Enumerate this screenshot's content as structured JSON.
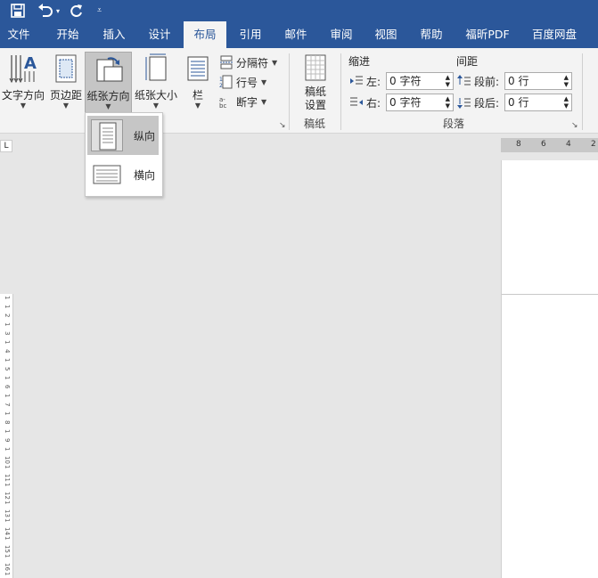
{
  "qat": {
    "save_icon": "save-icon",
    "undo_icon": "undo-icon",
    "redo_icon": "repeat-icon",
    "customize_icon": "customize-qat-icon"
  },
  "tabs": [
    "文件",
    "开始",
    "插入",
    "设计",
    "布局",
    "引用",
    "邮件",
    "审阅",
    "视图",
    "帮助",
    "福昕PDF",
    "百度网盘"
  ],
  "active_tab": "布局",
  "ribbon": {
    "text_direction": "文字方向",
    "margins": "页边距",
    "orientation": "纸张方向",
    "size": "纸张大小",
    "columns": "栏",
    "breaks": "分隔符",
    "line_numbers": "行号",
    "hyphenation": "断字",
    "draft_paper": "稿纸\n设置",
    "draft_paper_line1": "稿纸",
    "draft_paper_line2": "设置",
    "draft_group": "稿纸",
    "indent_label": "缩进",
    "spacing_label": "间距",
    "left_label": "左:",
    "right_label": "右:",
    "before_label": "段前:",
    "after_label": "段后:",
    "left_value": "0 字符",
    "right_value": "0 字符",
    "before_value": "0 行",
    "after_value": "0 行",
    "paragraph_group": "段落"
  },
  "orientation_menu": {
    "portrait": "纵向",
    "landscape": "横向"
  },
  "ruler": {
    "h_ticks": [
      "8",
      "6",
      "4",
      "2"
    ],
    "v_ticks": [
      "1",
      "1",
      "2",
      "1",
      "3",
      "1",
      "4",
      "1",
      "5",
      "1",
      "6",
      "1",
      "7",
      "1",
      "8",
      "1",
      "9",
      "1",
      "10",
      "1",
      "11",
      "1",
      "12",
      "1",
      "13",
      "1",
      "14",
      "1",
      "15",
      "1",
      "16",
      "1"
    ],
    "corner_symbol": "L"
  },
  "colors": {
    "accent": "#2b579a",
    "ribbon_bg": "#f3f3f3",
    "doc_bg": "#e6e6e6"
  }
}
